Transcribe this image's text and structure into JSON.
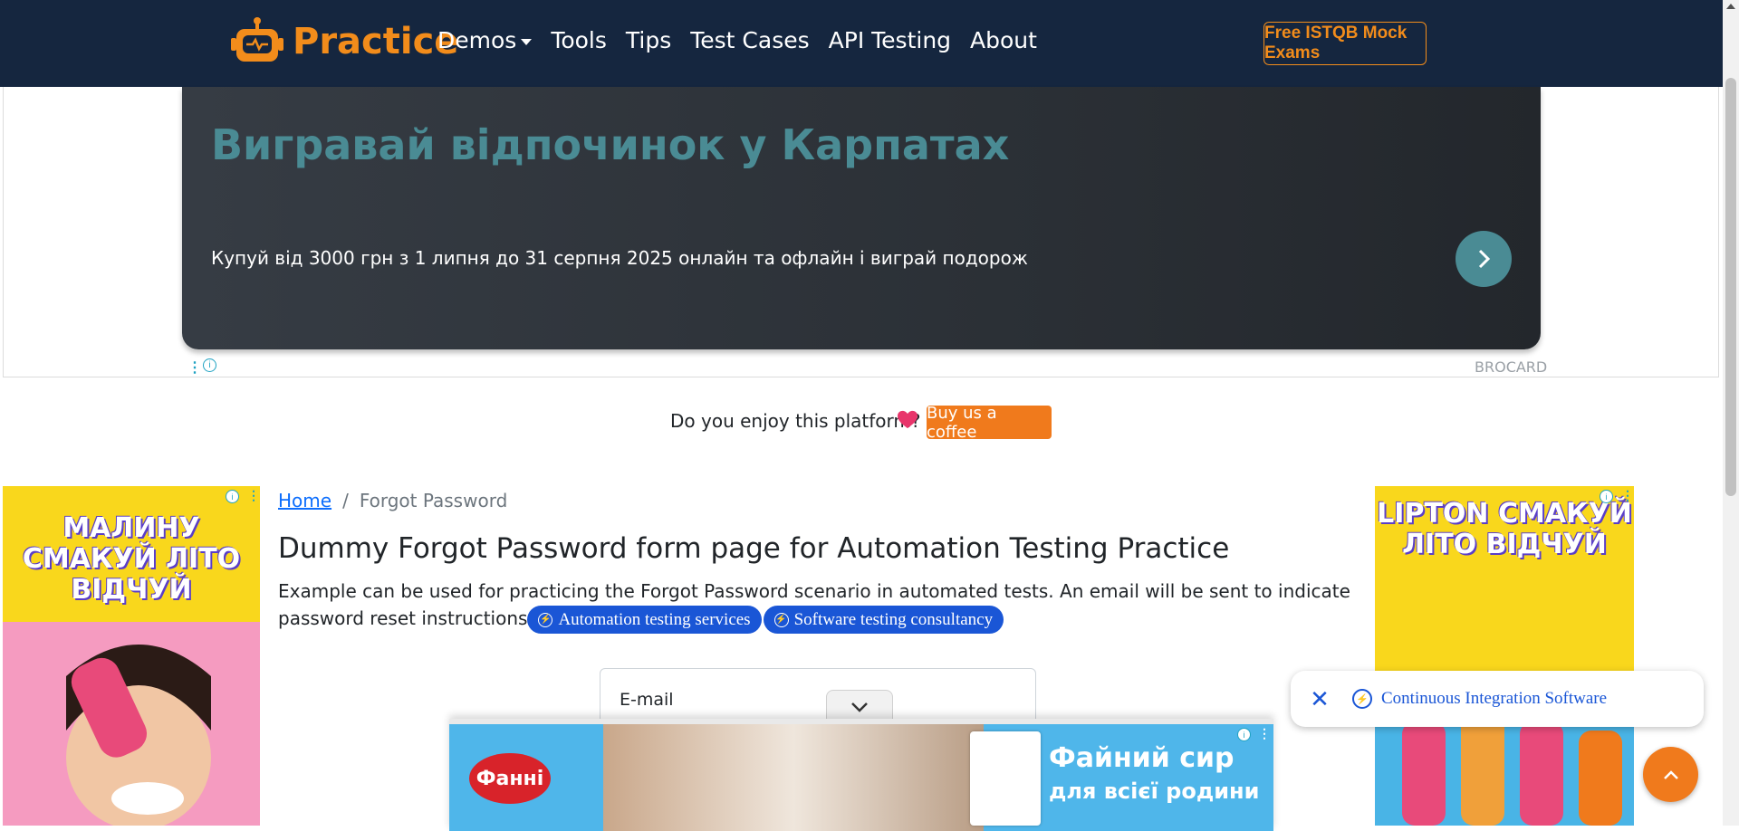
{
  "navbar": {
    "brand": "Practice",
    "items": [
      "Demos",
      "Tools",
      "Tips",
      "Test Cases",
      "API Testing",
      "About"
    ],
    "cta": "Free ISTQB Mock Exams",
    "bg_color": "#15263f",
    "accent_color": "#f28c1b"
  },
  "top_ad": {
    "headline": "Вигравай відпочинок у Карпатах",
    "subtext": "Купуй від 3000 грн з 1 липня до 31 серпня 2025 онлайн та офлайн і виграй подорож",
    "brand": "BROCARD",
    "arrow_icon": "chevron-right-icon"
  },
  "support": {
    "text": "Do you enjoy this platform?",
    "button": "Buy us a coffee"
  },
  "breadcrumb": {
    "home": "Home",
    "separator": "/",
    "current": "Forgot Password"
  },
  "main": {
    "title": "Dummy Forgot Password form page for Automation Testing Practice",
    "description": "Example can be used for practicing the Forgot Password scenario in automated tests. An email will be sent to indicate password reset instructions",
    "pills": [
      "Automation testing services",
      "Software testing consultancy"
    ]
  },
  "form": {
    "email_label": "E-mail"
  },
  "left_ad": {
    "headline": "МАЛИНУ СМАКУЙ ЛІТО ВІДЧУЙ"
  },
  "right_ad": {
    "headline": "LIPTON СМАКУЙ ЛІТО ВІДЧУЙ"
  },
  "bottom_ad": {
    "logo": "Фанні",
    "headline": "Файний сир",
    "subline": "для всієї родини"
  },
  "floating_card": {
    "text": "Continuous Integration Software"
  }
}
